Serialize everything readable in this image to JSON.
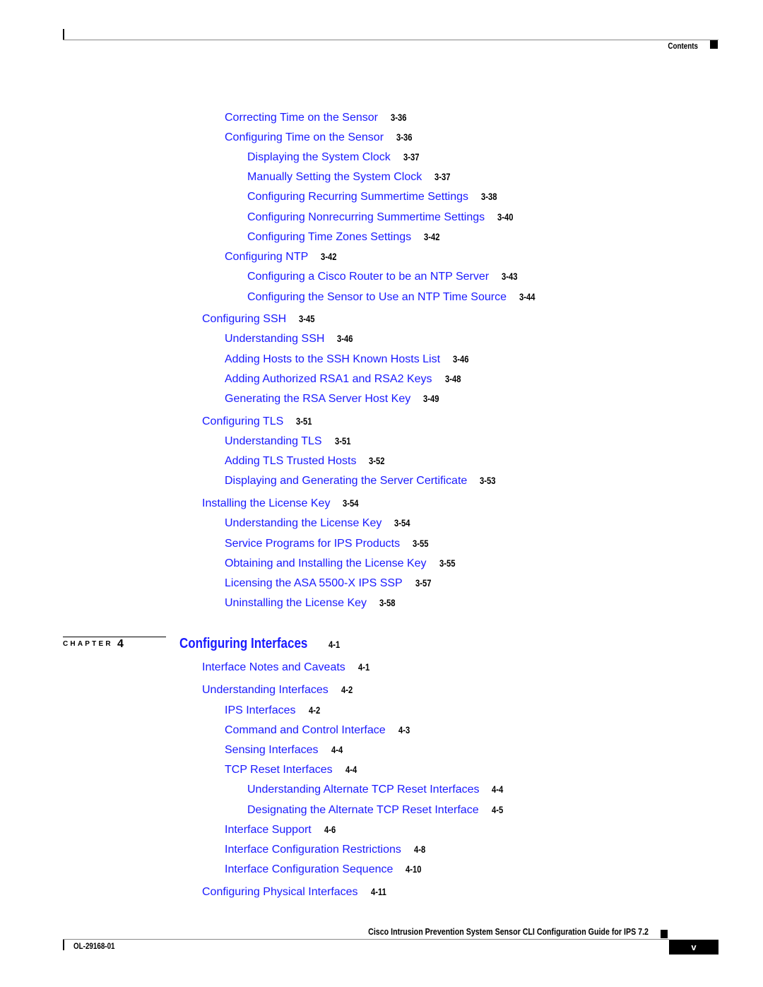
{
  "header": {
    "title": "Contents"
  },
  "entries_ch3": [
    {
      "title": "Correcting Time on the Sensor",
      "page": "3-36"
    },
    {
      "title": "Configuring Time on the Sensor",
      "page": "3-36"
    },
    {
      "title": "Displaying the System Clock",
      "page": "3-37"
    },
    {
      "title": "Manually Setting the System Clock",
      "page": "3-37"
    },
    {
      "title": "Configuring Recurring Summertime Settings",
      "page": "3-38"
    },
    {
      "title": "Configuring Nonrecurring Summertime Settings",
      "page": "3-40"
    },
    {
      "title": "Configuring Time Zones Settings",
      "page": "3-42"
    },
    {
      "title": "Configuring NTP",
      "page": "3-42"
    },
    {
      "title": "Configuring a Cisco Router to be an NTP Server",
      "page": "3-43"
    },
    {
      "title": "Configuring the Sensor to Use an NTP Time Source",
      "page": "3-44"
    },
    {
      "title": "Configuring SSH",
      "page": "3-45"
    },
    {
      "title": "Understanding SSH",
      "page": "3-46"
    },
    {
      "title": "Adding Hosts to the SSH Known Hosts List",
      "page": "3-46"
    },
    {
      "title": "Adding Authorized RSA1 and RSA2 Keys",
      "page": "3-48"
    },
    {
      "title": "Generating the RSA Server Host Key",
      "page": "3-49"
    },
    {
      "title": "Configuring TLS",
      "page": "3-51"
    },
    {
      "title": "Understanding TLS",
      "page": "3-51"
    },
    {
      "title": "Adding TLS Trusted Hosts",
      "page": "3-52"
    },
    {
      "title": "Displaying and Generating the Server Certificate",
      "page": "3-53"
    },
    {
      "title": "Installing the License Key",
      "page": "3-54"
    },
    {
      "title": "Understanding the License Key",
      "page": "3-54"
    },
    {
      "title": "Service Programs for IPS Products",
      "page": "3-55"
    },
    {
      "title": "Obtaining and Installing the License Key",
      "page": "3-55"
    },
    {
      "title": "Licensing the ASA 5500-X IPS SSP",
      "page": "3-57"
    },
    {
      "title": "Uninstalling the License Key",
      "page": "3-58"
    }
  ],
  "chapter": {
    "label": "CHAPTER",
    "number": "4",
    "title": "Configuring Interfaces",
    "page": "4-1"
  },
  "entries_ch4": [
    {
      "title": "Interface Notes and Caveats",
      "page": "4-1"
    },
    {
      "title": "Understanding Interfaces",
      "page": "4-2"
    },
    {
      "title": "IPS Interfaces",
      "page": "4-2"
    },
    {
      "title": "Command and Control Interface",
      "page": "4-3"
    },
    {
      "title": "Sensing Interfaces",
      "page": "4-4"
    },
    {
      "title": "TCP Reset Interfaces",
      "page": "4-4"
    },
    {
      "title": "Understanding Alternate TCP Reset Interfaces",
      "page": "4-4"
    },
    {
      "title": "Designating the Alternate TCP Reset Interface",
      "page": "4-5"
    },
    {
      "title": "Interface Support",
      "page": "4-6"
    },
    {
      "title": "Interface Configuration Restrictions",
      "page": "4-8"
    },
    {
      "title": "Interface Configuration Sequence",
      "page": "4-10"
    },
    {
      "title": "Configuring Physical Interfaces",
      "page": "4-11"
    }
  ],
  "footer": {
    "guide_title": "Cisco Intrusion Prevention System Sensor CLI Configuration Guide for IPS 7.2",
    "doc_number": "OL-29168-01",
    "page_number": "v"
  }
}
